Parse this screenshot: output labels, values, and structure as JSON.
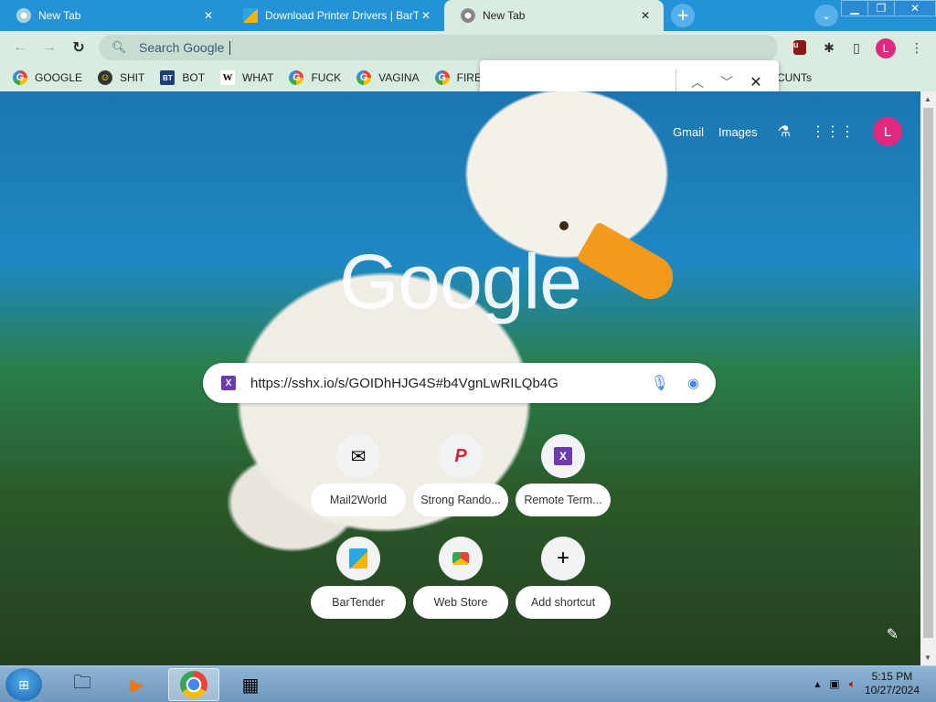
{
  "tabs": [
    {
      "title": "New Tab"
    },
    {
      "title": "Download Printer Drivers | BarTe"
    },
    {
      "title": "New Tab"
    }
  ],
  "omnibox": {
    "text": "Search Google"
  },
  "bookmarks": [
    {
      "label": "GOOGLE"
    },
    {
      "label": "SHIT"
    },
    {
      "label": "BOT"
    },
    {
      "label": "WHAT"
    },
    {
      "label": "FUCK"
    },
    {
      "label": "VAGINA"
    },
    {
      "label": "FIREFOX"
    }
  ],
  "bookmarks_tail": "CUNTs",
  "profile_initial": "L",
  "find_bar": {
    "query": ""
  },
  "ntp": {
    "gmail": "Gmail",
    "images": "Images",
    "logo": "Google",
    "search_value": "https://sshx.io/s/GOIDhHJG4S#b4VgnLwRILQb4G",
    "shortcuts": [
      {
        "label": "Mail2World"
      },
      {
        "label": "Strong Rando..."
      },
      {
        "label": "Remote Term..."
      },
      {
        "label": "BarTender"
      },
      {
        "label": "Web Store"
      },
      {
        "label": "Add shortcut"
      }
    ]
  },
  "taskbar": {
    "time": "5:15 PM",
    "date": "10/27/2024"
  },
  "colors": {
    "tabstrip": "#2492d6",
    "toolbar": "#d9ece0",
    "avatar": "#e0287e"
  }
}
